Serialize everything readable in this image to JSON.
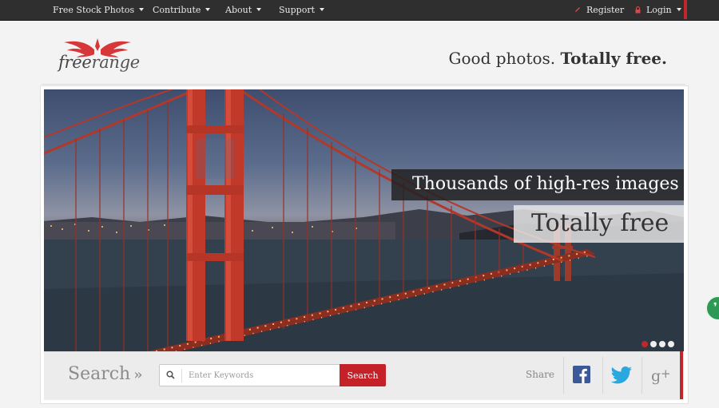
{
  "topbar": {
    "nav": [
      {
        "label": "Free Stock Photos"
      },
      {
        "label": "Contribute"
      },
      {
        "label": "About"
      },
      {
        "label": "Support"
      }
    ],
    "register_label": "Register",
    "login_label": "Login"
  },
  "brand": {
    "logo_prefix": "free",
    "logo_suffix": "range",
    "tagline_regular": "Good photos.",
    "tagline_bold": "Totally free."
  },
  "hero": {
    "caption_primary": "Thousands of high-res images",
    "caption_secondary": "Totally free",
    "slide_count": 4,
    "active_slide": 1
  },
  "search": {
    "label": "Search",
    "chevron": "»",
    "placeholder": "Enter Keywords",
    "button_label": "Search"
  },
  "share": {
    "label": "Share",
    "networks": [
      "facebook-icon",
      "twitter-icon",
      "google-plus-icon"
    ]
  },
  "colors": {
    "accent_red": "#c42128",
    "topbar_bg": "#2f2f2f",
    "facebook": "#3b5998",
    "twitter": "#29a8e0",
    "chat_green": "#2c9a55"
  }
}
